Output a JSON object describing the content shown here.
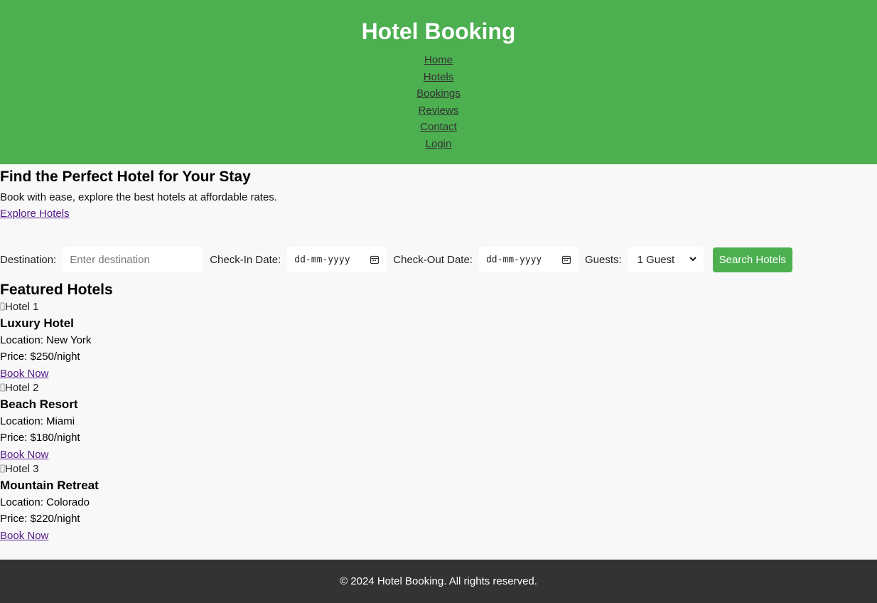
{
  "header": {
    "title": "Hotel Booking",
    "nav": [
      {
        "label": "Home"
      },
      {
        "label": "Hotels"
      },
      {
        "label": "Bookings"
      },
      {
        "label": "Reviews"
      },
      {
        "label": "Contact"
      },
      {
        "label": "Login"
      }
    ]
  },
  "hero": {
    "heading": "Find the Perfect Hotel for Your Stay",
    "subtitle": "Book with ease, explore the best hotels at affordable rates.",
    "cta": "Explore Hotels"
  },
  "search": {
    "destination_label": "Destination:",
    "destination_placeholder": "Enter destination",
    "checkin_label": "Check-In Date:",
    "checkin_value": "dd-mm-yyyy",
    "checkout_label": "Check-Out Date:",
    "checkout_value": "dd-mm-yyyy",
    "guests_label": "Guests:",
    "guests_value": "1 Guest",
    "button": "Search Hotels"
  },
  "featured": {
    "heading": "Featured Hotels",
    "hotels": [
      {
        "alt": "Hotel 1",
        "name": "Luxury Hotel",
        "location": "Location: New York",
        "price": "Price: $250/night",
        "cta": "Book Now"
      },
      {
        "alt": "Hotel 2",
        "name": "Beach Resort",
        "location": "Location: Miami",
        "price": "Price: $180/night",
        "cta": "Book Now"
      },
      {
        "alt": "Hotel 3",
        "name": "Mountain Retreat",
        "location": "Location: Colorado",
        "price": "Price: $220/night",
        "cta": "Book Now"
      }
    ]
  },
  "footer": {
    "text": "© 2024 Hotel Booking. All rights reserved."
  },
  "colors": {
    "header_bg": "#4caf50",
    "accent": "#4caf50",
    "footer_bg": "#333333",
    "page_bg": "#f8f8f8",
    "visited_link": "#551a8b"
  }
}
